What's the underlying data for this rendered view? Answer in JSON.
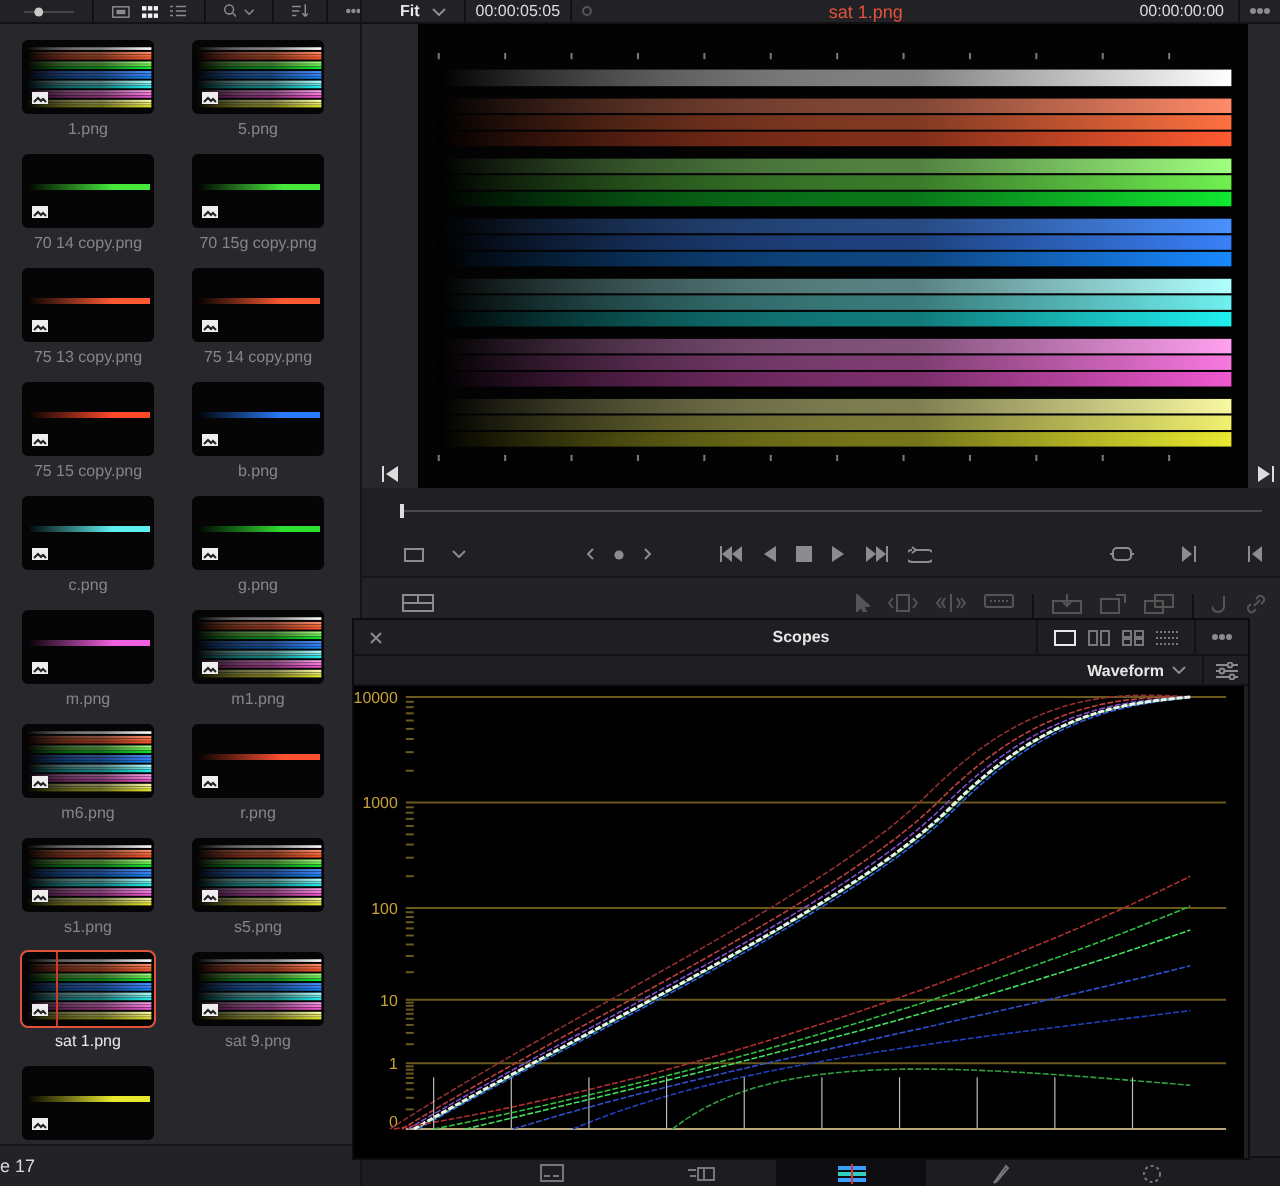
{
  "media_pool": {
    "zoom_slider": {
      "level": 0.25
    },
    "view_modes": [
      {
        "kind": "strip",
        "selected": false
      },
      {
        "kind": "grid",
        "selected": true
      },
      {
        "kind": "list",
        "selected": false
      }
    ],
    "clips": [
      {
        "label": "1.png",
        "kind": "bars",
        "selected": false
      },
      {
        "label": "5.png",
        "kind": "bars",
        "selected": false
      },
      {
        "label": "70 14 copy.png",
        "kind": "line",
        "color": "#46e83a",
        "selected": false
      },
      {
        "label": "70 15g copy.png",
        "kind": "line",
        "color": "#46e83a",
        "selected": false
      },
      {
        "label": "75 13 copy.png",
        "kind": "line",
        "color": "#ff5a34",
        "selected": false
      },
      {
        "label": "75 14 copy.png",
        "kind": "line",
        "color": "#ff5a34",
        "selected": false
      },
      {
        "label": "75 15 copy.png",
        "kind": "line",
        "color": "#ff4a2a",
        "selected": false
      },
      {
        "label": "b.png",
        "kind": "line",
        "color": "#2a7cff",
        "selected": false
      },
      {
        "label": "c.png",
        "kind": "line",
        "color": "#5ef0f0",
        "selected": false
      },
      {
        "label": "g.png",
        "kind": "line",
        "color": "#30e030",
        "selected": false
      },
      {
        "label": "m.png",
        "kind": "line",
        "color": "#f060e0",
        "selected": false
      },
      {
        "label": "m1.png",
        "kind": "bars",
        "selected": false
      },
      {
        "label": "m6.png",
        "kind": "bars",
        "selected": false
      },
      {
        "label": "r.png",
        "kind": "line",
        "color": "#ff5030",
        "selected": false
      },
      {
        "label": "s1.png",
        "kind": "bars",
        "selected": false
      },
      {
        "label": "s5.png",
        "kind": "bars",
        "selected": false
      },
      {
        "label": "sat 1.png",
        "kind": "bars",
        "selected": true
      },
      {
        "label": "sat 9.png",
        "kind": "bars",
        "selected": false
      },
      {
        "kind": "line",
        "color": "#e8e830",
        "selected": false
      }
    ],
    "status_text": "e 17"
  },
  "viewer": {
    "zoom": "Fit",
    "timecode": "00:00:05:05",
    "clip_title": "sat 1.png",
    "position_timecode": "00:00:00:00",
    "scrubber": {
      "level": 0
    }
  },
  "scopes": {
    "title": "Scopes",
    "layouts": [
      {
        "kind": "single",
        "selected": true
      },
      {
        "kind": "dual",
        "selected": false
      },
      {
        "kind": "quad",
        "selected": false
      },
      {
        "kind": "grid",
        "selected": false
      }
    ],
    "scope_type": "Waveform",
    "scale_labels": [
      "10000",
      "1000",
      "100",
      "10",
      "1",
      "0"
    ]
  },
  "page_bar": {
    "pages": [
      {
        "kind": "media",
        "selected": false
      },
      {
        "kind": "cut",
        "selected": false
      },
      {
        "kind": "color",
        "selected": true
      },
      {
        "kind": "pen",
        "selected": false
      },
      {
        "kind": "deliver",
        "selected": false
      }
    ]
  }
}
